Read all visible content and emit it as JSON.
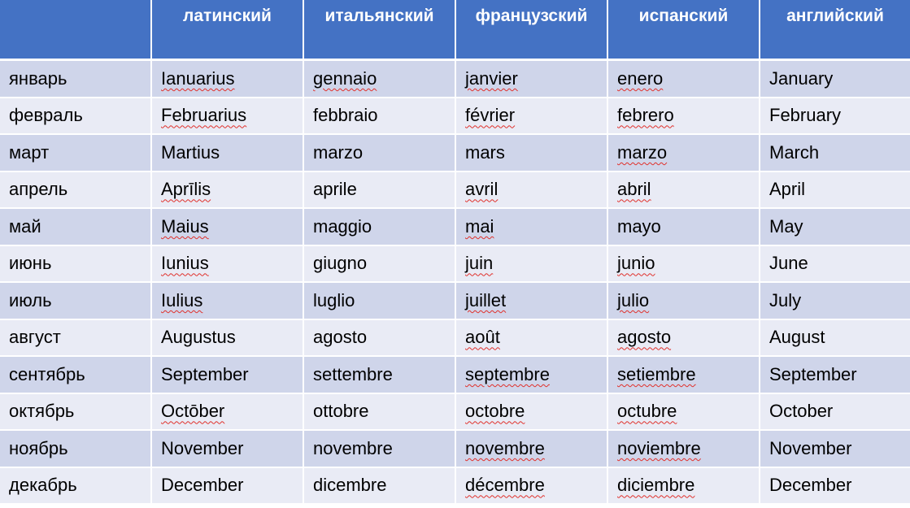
{
  "colors": {
    "header": "#4472C4",
    "row_odd": "#CFD5EA",
    "row_even": "#E9EBF5",
    "spellcheck": "#e0302b"
  },
  "table": {
    "headers": [
      "",
      "латинский",
      "итальянский",
      "французский",
      "испанский",
      "английский"
    ],
    "rows": [
      {
        "cells": [
          "январь",
          "Ianuarius",
          "gennaio",
          "janvier",
          "enero",
          "January"
        ],
        "misspelled": [
          false,
          true,
          true,
          true,
          true,
          false
        ]
      },
      {
        "cells": [
          "февраль",
          "Februarius",
          "febbraio",
          "février",
          "febrero",
          "February"
        ],
        "misspelled": [
          false,
          true,
          false,
          true,
          true,
          false
        ]
      },
      {
        "cells": [
          "март",
          "Martius",
          "marzo",
          "mars",
          "marzo",
          "March"
        ],
        "misspelled": [
          false,
          false,
          false,
          false,
          true,
          false
        ]
      },
      {
        "cells": [
          "апрель",
          "Aprīlis",
          "aprile",
          "avril",
          "abril",
          "April"
        ],
        "misspelled": [
          false,
          true,
          false,
          true,
          true,
          false
        ]
      },
      {
        "cells": [
          "май",
          "Maius",
          "maggio",
          "mai",
          "mayo",
          "May"
        ],
        "misspelled": [
          false,
          true,
          false,
          true,
          false,
          false
        ]
      },
      {
        "cells": [
          "июнь",
          "Iunius",
          "giugno",
          "juin",
          "junio",
          "June"
        ],
        "misspelled": [
          false,
          true,
          false,
          true,
          true,
          false
        ]
      },
      {
        "cells": [
          "июль",
          "Iulius",
          "luglio",
          "juillet",
          "julio",
          "July"
        ],
        "misspelled": [
          false,
          true,
          false,
          true,
          true,
          false
        ]
      },
      {
        "cells": [
          "август",
          "Augustus",
          "agosto",
          "août",
          "agosto",
          "August"
        ],
        "misspelled": [
          false,
          false,
          false,
          true,
          true,
          false
        ]
      },
      {
        "cells": [
          "сентябрь",
          "September",
          "settembre",
          "septembre",
          "setiembre",
          "September"
        ],
        "misspelled": [
          false,
          false,
          false,
          true,
          true,
          false
        ]
      },
      {
        "cells": [
          "октябрь",
          "Octōber",
          "ottobre",
          "octobre",
          "octubre",
          "October"
        ],
        "misspelled": [
          false,
          true,
          false,
          true,
          true,
          false
        ]
      },
      {
        "cells": [
          "ноябрь",
          "November",
          "novembre",
          "novembre",
          "noviembre",
          "November"
        ],
        "misspelled": [
          false,
          false,
          false,
          true,
          true,
          false
        ]
      },
      {
        "cells": [
          "декабрь",
          "December",
          "dicembre",
          "décembre",
          "diciembre",
          "December"
        ],
        "misspelled": [
          false,
          false,
          false,
          true,
          true,
          false
        ]
      }
    ]
  }
}
